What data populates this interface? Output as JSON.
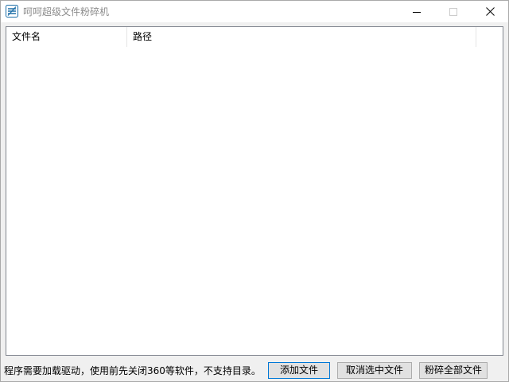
{
  "window": {
    "title": "呵呵超级文件粉碎机"
  },
  "list": {
    "columns": [
      "文件名",
      "路径"
    ]
  },
  "footer": {
    "hint": "程序需要加载驱动，使用前先关闭360等软件，不支持目录。",
    "add_label": "添加文件",
    "deselect_label": "取消选中文件",
    "shred_all_label": "粉碎全部文件"
  },
  "icons": {
    "app": "app-icon",
    "minimize": "minimize-icon",
    "maximize": "maximize-icon",
    "close": "close-icon"
  },
  "colors": {
    "accent": "#0078d7",
    "app_icon": "#1e6fa8"
  }
}
